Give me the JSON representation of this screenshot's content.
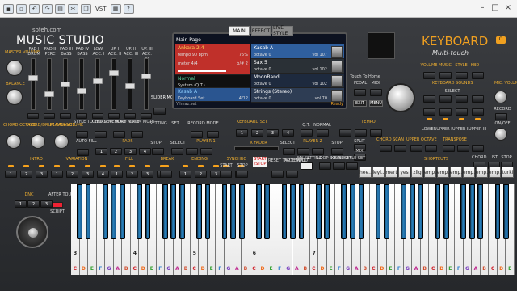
{
  "titlebar": {
    "icons": [
      "save-icon",
      "open-icon",
      "undo-icon",
      "redo-icon",
      "print-icon",
      "cut-icon",
      "copy-icon",
      "paste-icon",
      "help-icon"
    ],
    "vst_label": "VST"
  },
  "brand": {
    "site": "sofeh.com",
    "name": "MUSIC STUDIO"
  },
  "keyboard_brand": {
    "title": "KEYBOARD",
    "subtitle": "Multi-touch",
    "switch_label": "O"
  },
  "screen": {
    "tabs": [
      "MAIN",
      "EFFECT",
      "LIVE STYLE"
    ],
    "header": "Main Page",
    "left_slots": [
      {
        "name": "Ankara 2.4",
        "l1": "tempo 90 bpm",
        "r1": "75%",
        "l2": "meter 4/4",
        "r2": "b/# 2"
      },
      {
        "name": "Normal",
        "l1": "System (Q.T.)",
        "r1": "",
        "l2": "",
        "r2": ""
      },
      {
        "name": "Kasab A",
        "l1": "Keyboard Set",
        "r1": "4/12",
        "l2": "",
        "r2": ""
      }
    ],
    "right_slots": [
      {
        "name": "Kasab A",
        "l": "octave 0",
        "r": "vol 107"
      },
      {
        "name": "Sax 5",
        "l": "octave 0",
        "r": "vol 102"
      },
      {
        "name": "MoonBand",
        "l": "octave 0",
        "r": "vol 102"
      },
      {
        "name": "Strings (Stereo)",
        "l": "octave 0",
        "r": "vol 70"
      }
    ],
    "footer_left": "Yilmaz.set",
    "footer_right": "Ready",
    "btns": [
      "EXIT",
      "MENU"
    ]
  },
  "left": {
    "master_volume": "MASTER VOLUME",
    "balance": "BALANCE",
    "pad_labels": [
      "PAD I DRUM",
      "PAD II PERC",
      "PAD III BASS",
      "PAD IV BASS",
      "LOW. ACC. I",
      "UP. I ACC. II",
      "UP. II ACC. III",
      "UP. III ACC. IV"
    ],
    "slider_mode": "SLIDER MODE",
    "chord_octave": "CHORD OCTAVE",
    "chord_drum_balance": "CHORD/DRUM BALANCE",
    "player_volume": "PLAYER VOLUME",
    "style_kbd": "STYLE TO KBD SET",
    "chord_memory": "CHORD MEMORY",
    "chord_mute": "CHORD MUTE",
    "drum_mute": "DRUM MUTE",
    "auto_fill": "AUTO FILL",
    "setting": "SETTING",
    "set": "SET",
    "record": "RECORD",
    "mode": "MODE",
    "pads": "PADS",
    "stop": "STOP",
    "intro": "INTRO",
    "variation": "VARIATION",
    "fill": "FILL",
    "break": "BREAK",
    "ending": "ENDING",
    "synchro": "SYNCHRO",
    "start": "START",
    "start_stop": "START /STOP",
    "reset": "RESET TAP TEMPO",
    "fade": "FADE IN/OUT",
    "dnc": "DNC",
    "after_touch": "AFTER TOUCH",
    "script": "SCRIPT",
    "player1": "PLAYER 1",
    "player2": "PLAYER 2",
    "x_fader": "X FADER",
    "select": "SELECT"
  },
  "right": {
    "keyboard_set": "KEYBOARD SET",
    "qt": "Q.T.",
    "normal": "NORMAL",
    "tempo": "TEMPO",
    "pedal": "PEDAL",
    "midi": "MIDI",
    "volume": "VOLUME",
    "fx": "FX",
    "music": "MUSIC",
    "style": "STYLE",
    "kbd": "KBD",
    "keyboard_sounds": "KEYBOARD SOUNDS",
    "mic_volume": "MIC. VOLUME",
    "record": "RECORD",
    "on_off": "ON/OFF",
    "lower": "LOWER",
    "upper1": "UPPER I",
    "upper2": "UPPER II",
    "upper3": "UPPER III",
    "split": "SPLIT",
    "mix": "MIX",
    "chord_scan": "CHORD SCAN",
    "upper_octave": "UPPER OCTAVE",
    "transpose": "TRANSPOSE",
    "chord": "CHORD",
    "list": "LIST",
    "my_setting": "MY SETTING",
    "loop_sound": "LOOP SOUND",
    "keyb_set": "KEYB. SET",
    "style_set": "STYLE SET",
    "shortcuts": "SHORTCUTS",
    "touch_home": "Touch To Home",
    "shortcut_keys": [
      "hee..",
      "leyl..",
      "mert",
      "yes",
      "zllg",
      "emp.",
      "emp.",
      "emp.",
      "emp.",
      "emp.",
      "emp.",
      "turki"
    ]
  },
  "keys": {
    "white_notes": [
      "C",
      "D",
      "E",
      "F",
      "G",
      "A",
      "B",
      "C",
      "D",
      "E",
      "F",
      "G",
      "A",
      "B",
      "C",
      "D",
      "E",
      "F",
      "G",
      "A",
      "B",
      "C",
      "D",
      "E",
      "F",
      "G",
      "A",
      "B",
      "C",
      "D",
      "E",
      "F",
      "G",
      "A",
      "B",
      "C",
      "D",
      "E",
      "F",
      "G",
      "A",
      "B",
      "C",
      "D",
      "E",
      "F",
      "G",
      "A",
      "B",
      "C",
      "D",
      "E"
    ],
    "octave_numbers": [
      "3",
      "4",
      "5",
      "6",
      "7"
    ],
    "colors": {
      "C": "#d0202a",
      "D": "#f06a1a",
      "E": "#2fa02a",
      "F": "#2f80d0",
      "G": "#7a40c0",
      "A": "#c02a90",
      "B": "#d04a2a"
    }
  }
}
